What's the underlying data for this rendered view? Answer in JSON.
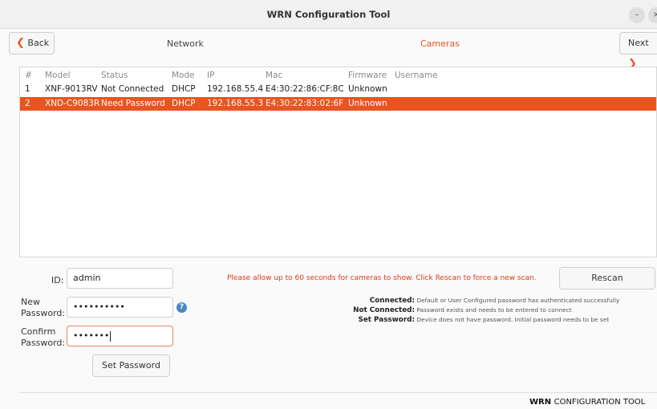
{
  "window": {
    "title": "WRN Configuration Tool",
    "minimize": "–",
    "close": "×"
  },
  "nav": {
    "back_label": "Back",
    "next_label": "Next",
    "steps": [
      "Network",
      "Cameras"
    ]
  },
  "table": {
    "headers": [
      "#",
      "Model",
      "Status",
      "Mode",
      "IP",
      "Mac",
      "Firmware",
      "Username"
    ],
    "rows": [
      [
        "1",
        "XNF-9013RV",
        "Not Connected",
        "DHCP",
        "192.168.55.4",
        "E4:30:22:86:CF:8C",
        "Unknown",
        ""
      ],
      [
        "2",
        "XND-C9083R",
        "Need Password",
        "DHCP",
        "192.168.55.3",
        "E4:30:22:83:02:6F",
        "Unknown",
        ""
      ]
    ]
  },
  "form": {
    "id_label": "ID:",
    "id_value": "admin",
    "new_password_label": [
      "New",
      "Password:"
    ],
    "new_password_value": "••••••••••",
    "confirm_password_label": [
      "Confirm",
      "Password:"
    ],
    "confirm_password_value": "•••••••",
    "help_icon": "?",
    "set_password_label": "Set Password"
  },
  "scan": {
    "notice": "Please allow up to 60 seconds for cameras to show. Click Rescan to force a new scan.",
    "rescan_label": "Rescan"
  },
  "legend": [
    {
      "key": "Connected:",
      "text": "Default or User Configured password has authenticated successfully"
    },
    {
      "key": "Not Connected:",
      "text": "Password exists and needs to be entered to connect"
    },
    {
      "key": "Set Password:",
      "text": "Device does not have password. Initial password needs to be set"
    }
  ],
  "footer": {
    "brand_bold": "WRN",
    "brand_rest": "CONFIGURATION TOOL"
  },
  "colors": {
    "accent": "#e95420",
    "notice": "#d63b18",
    "help_icon": "#4a86c5"
  }
}
